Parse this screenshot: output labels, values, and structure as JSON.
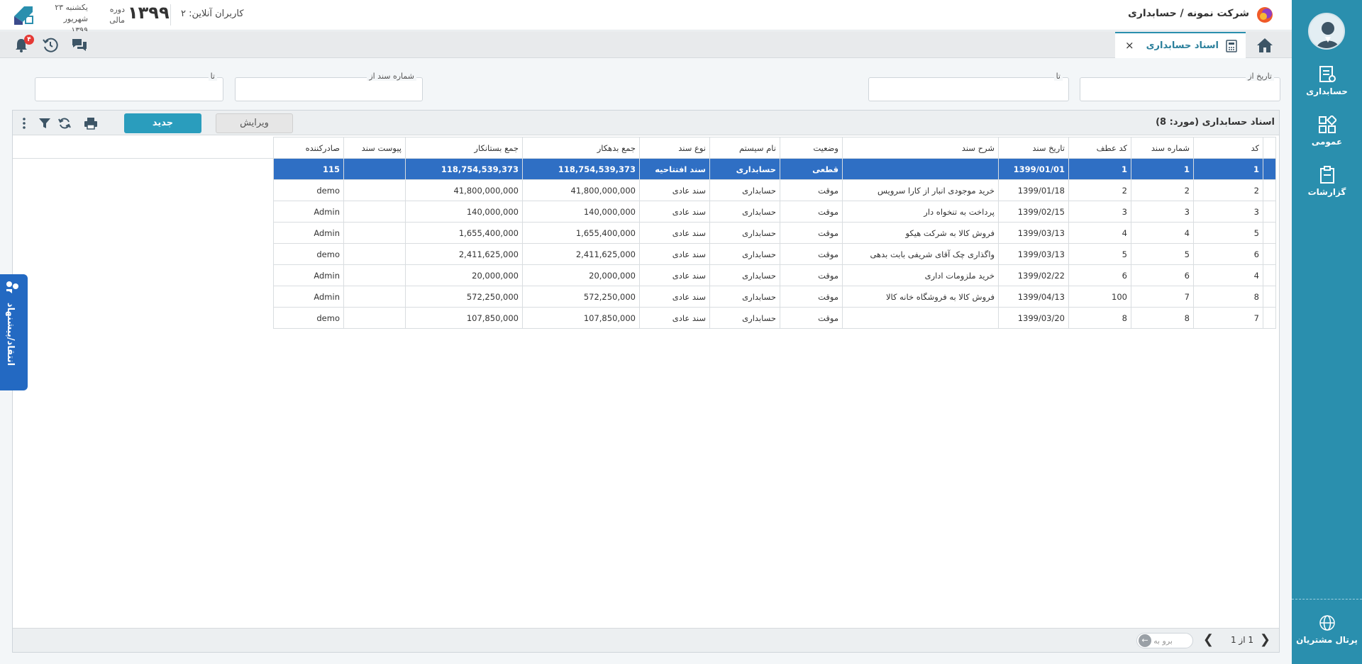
{
  "header": {
    "company_path": "شرکت نمونه / حسابداری",
    "online_users": "کاربران آنلاین: ۲",
    "fiscal_year": "۱۳۹۹",
    "fiscal_label_1": "دوره",
    "fiscal_label_2": "مالی",
    "weekday": "یکشنبه ۲۳",
    "month_year": "شهریور ۱۳۹۹",
    "notification_count": "۴"
  },
  "tabs": {
    "active_tab": "اسناد حسابداری",
    "close_symbol": "×"
  },
  "sidebar": {
    "items": [
      {
        "label": "حسابداری",
        "icon": "accounting-icon"
      },
      {
        "label": "عمومی",
        "icon": "general-icon"
      },
      {
        "label": "گزارشات",
        "icon": "reports-icon"
      }
    ],
    "portal_label": "پرتال مشتریان"
  },
  "filters": {
    "date_from": "تاریخ از",
    "date_to": "تا",
    "doc_from": "شماره سند از",
    "doc_to": "تا"
  },
  "toolbar": {
    "title": "اسناد حسابداری (مورد:  8)",
    "new_label": "جدید",
    "edit_label": "ویرایش"
  },
  "table": {
    "columns": [
      "کد",
      "شماره سند",
      "کد عطف",
      "تاریخ سند",
      "شرح سند",
      "وضعیت",
      "نام سیستم",
      "نوع سند",
      "جمع بدهکار",
      "جمع بستانکار",
      "پیوست سند",
      "صادرکننده"
    ],
    "rows": [
      [
        "1",
        "1",
        "1",
        "1399/01/01",
        "",
        "قطعی",
        "حسابداری",
        "سند افتتاحیه",
        "118,754,539,373",
        "118,754,539,373",
        "",
        "115"
      ],
      [
        "2",
        "2",
        "2",
        "1399/01/18",
        "خرید موجودی انبار از کارا سرویس",
        "موقت",
        "حسابداری",
        "سند عادی",
        "41,800,000,000",
        "41,800,000,000",
        "",
        "demo"
      ],
      [
        "3",
        "3",
        "3",
        "1399/02/15",
        "پرداخت به تنخواه دار",
        "موقت",
        "حسابداری",
        "سند عادی",
        "140,000,000",
        "140,000,000",
        "",
        "Admin"
      ],
      [
        "5",
        "4",
        "4",
        "1399/03/13",
        "فروش کالا به شرکت هیکو",
        "موقت",
        "حسابداری",
        "سند عادی",
        "1,655,400,000",
        "1,655,400,000",
        "",
        "Admin"
      ],
      [
        "6",
        "5",
        "5",
        "1399/03/13",
        "واگذاری چک آقای شریفی بابت بدهی",
        "موقت",
        "حسابداری",
        "سند عادی",
        "2,411,625,000",
        "2,411,625,000",
        "",
        "demo"
      ],
      [
        "4",
        "6",
        "6",
        "1399/02/22",
        "خرید ملزومات اداری",
        "موقت",
        "حسابداری",
        "سند عادی",
        "20,000,000",
        "20,000,000",
        "",
        "Admin"
      ],
      [
        "8",
        "7",
        "100",
        "1399/04/13",
        "فروش کالا به فروشگاه خانه کالا",
        "موقت",
        "حسابداری",
        "سند عادی",
        "572,250,000",
        "572,250,000",
        "",
        "Admin"
      ],
      [
        "7",
        "8",
        "8",
        "1399/03/20",
        "",
        "موقت",
        "حسابداری",
        "سند عادی",
        "107,850,000",
        "107,850,000",
        "",
        "demo"
      ]
    ],
    "selected_row": 0
  },
  "pager": {
    "page_info": "1  از  1",
    "goto_placeholder": "برو به"
  },
  "feedback": {
    "label": "انتقاد/پیشنهاد"
  },
  "colors": {
    "sidebar": "#2a8fae",
    "primary_button": "#2a9dbd",
    "selected_row": "#2f6fc4",
    "feedback_tab": "#2369c2",
    "badge": "#e53935"
  }
}
